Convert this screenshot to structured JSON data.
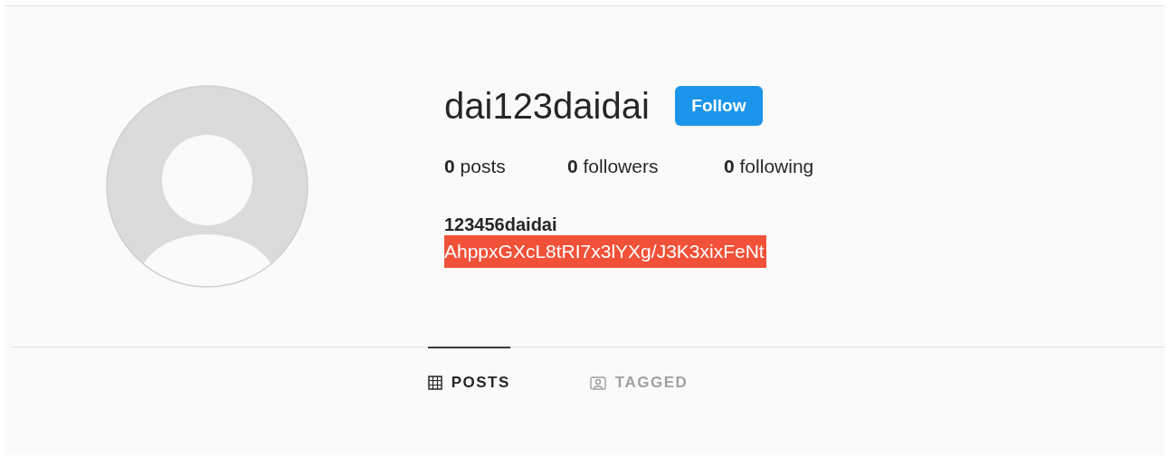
{
  "profile": {
    "username": "dai123daidai",
    "follow_button": "Follow",
    "stats": [
      {
        "count": "0",
        "label": "posts"
      },
      {
        "count": "0",
        "label": "followers"
      },
      {
        "count": "0",
        "label": "following"
      }
    ],
    "name": "123456daidai",
    "bio": "AhppxGXcL8tRI7x3lYXg/J3K3xixFeNt",
    "bio_highlighted": true
  },
  "tabs": [
    {
      "label": "POSTS",
      "kind": "grid",
      "selected": true
    },
    {
      "label": "TAGGED",
      "kind": "tag",
      "selected": false
    }
  ]
}
